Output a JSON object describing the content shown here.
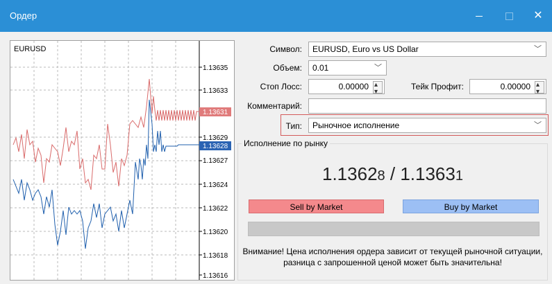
{
  "window": {
    "title": "Ордер",
    "close_glyph": "✕"
  },
  "chart": {
    "symbol": "EURUSD",
    "price_labels": [
      "1.13635",
      "1.13633",
      "1.13631",
      "1.13629",
      "1.13628",
      "1.13627",
      "1.13624",
      "1.13622",
      "1.13620",
      "1.13618",
      "1.13616"
    ],
    "ask_label": "1.13631",
    "bid_label": "1.13628",
    "colors": {
      "ask": "#e05c5c",
      "bid": "#1f5fad"
    }
  },
  "form": {
    "symbol_label": "Символ:",
    "symbol_value": "EURUSD, Euro vs US Dollar",
    "volume_label": "Объем:",
    "volume_value": "0.01",
    "sl_label": "Стоп Лосс:",
    "sl_value": "0.00000",
    "tp_label": "Тейк Профит:",
    "tp_value": "0.00000",
    "comment_label": "Комментарий:",
    "comment_value": "",
    "type_label": "Тип:",
    "type_value": "Рыночное исполнение"
  },
  "market": {
    "group_title": "Исполнение по рынку",
    "bid_main": "1.1362",
    "bid_last": "8",
    "separator": " / ",
    "ask_main": "1.1363",
    "ask_last": "1",
    "sell_label": "Sell by Market",
    "buy_label": "Buy by Market",
    "warning_line1": "Внимание! Цена исполнения ордера зависит от текущей рыночной ситуации,",
    "warning_line2": "разница с запрошенной ценой может быть значительна!"
  }
}
